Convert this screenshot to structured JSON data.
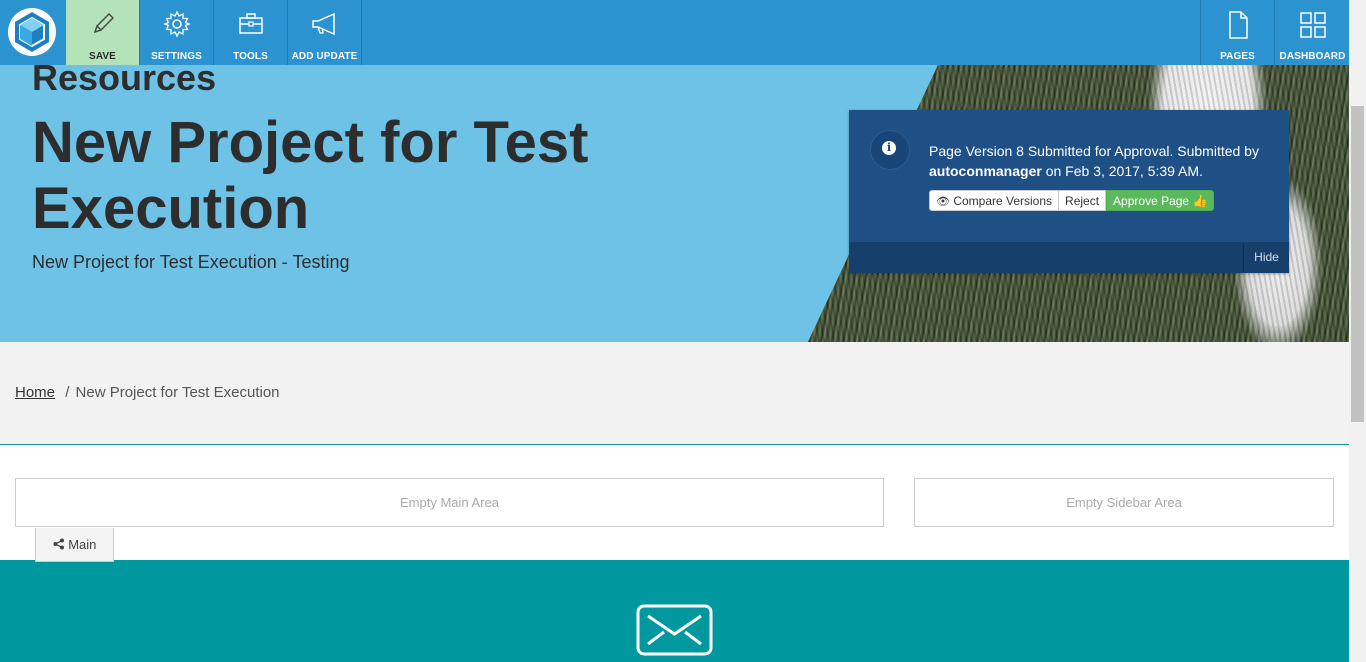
{
  "toolbar": {
    "save_label": "SAVE",
    "settings_label": "SETTINGS",
    "tools_label": "TOOLS",
    "add_update_label": "ADD UPDATE",
    "pages_label": "PAGES",
    "dashboard_label": "DASHBOARD"
  },
  "hero": {
    "section": "Resources",
    "title": "New Project for Test Execution",
    "subtitle": "New Project for Test Execution - Testing"
  },
  "approval": {
    "message_prefix": "Page Version 8 Submitted for Approval. Submitted by",
    "user": "autoconmanager",
    "message_suffix": "on Feb 3, 2017, 5:39 AM.",
    "compare_label": "Compare Versions",
    "reject_label": "Reject",
    "approve_label": "Approve Page",
    "hide_label": "Hide"
  },
  "breadcrumb": {
    "home": "Home",
    "separator": "/",
    "current": "New Project for Test Execution"
  },
  "areas": {
    "main": "Empty Main Area",
    "sidebar": "Empty Sidebar Area",
    "main_tab": "Main"
  },
  "colors": {
    "toolbar": "#2b93cf",
    "hero": "#6ec2e6",
    "panel": "#1e4f85",
    "approve": "#5cb85c",
    "footer": "#00989f"
  }
}
